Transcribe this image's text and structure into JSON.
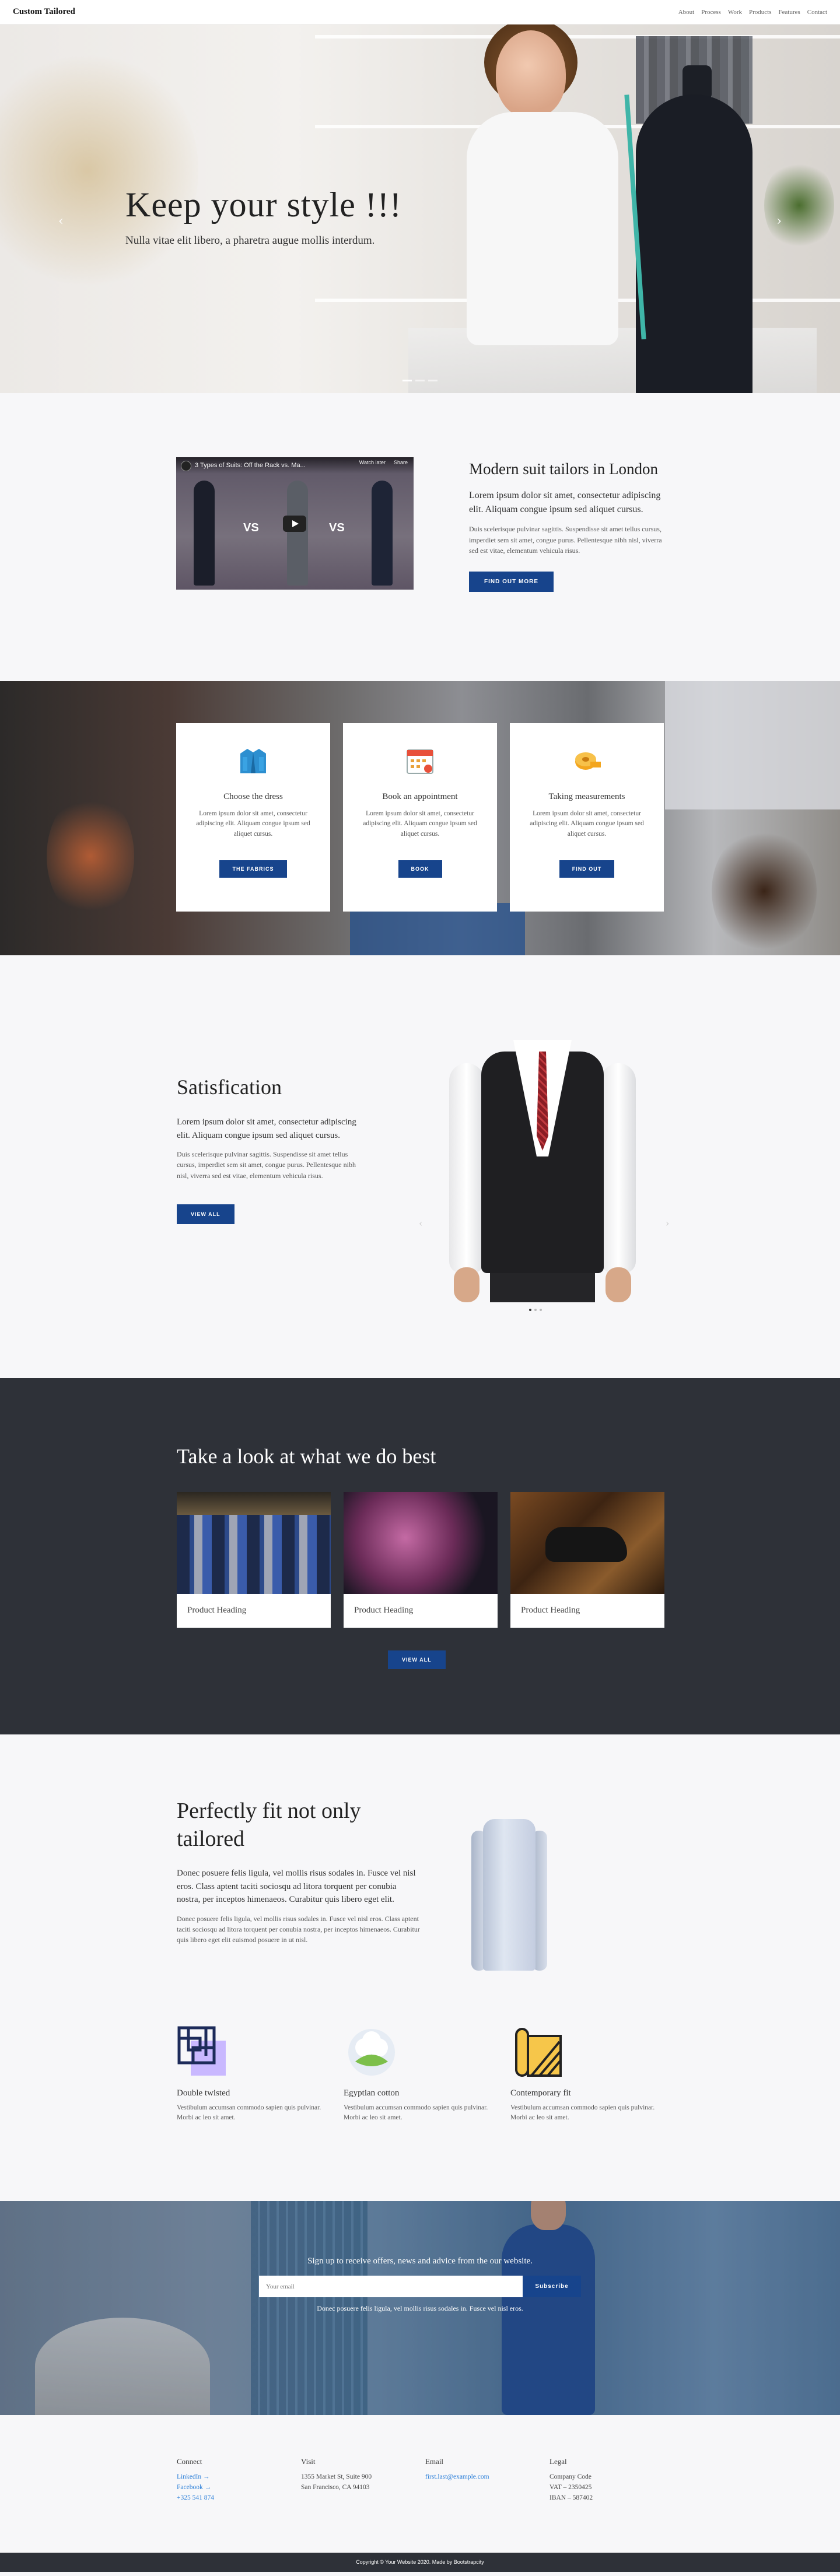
{
  "nav": {
    "brand": "Custom Tailored",
    "links": [
      "About",
      "Process",
      "Work",
      "Products",
      "Features",
      "Contact"
    ]
  },
  "hero": {
    "title": "Keep your style !!!",
    "subtitle": "Nulla vitae elit libero, a pharetra augue mollis interdum.",
    "prev": "‹",
    "next": "›"
  },
  "intro": {
    "video_title": "3 Types of Suits: Off the Rack vs. Ma...",
    "video_watch_later": "Watch later",
    "video_share": "Share",
    "vs1": "VS",
    "vs2": "VS",
    "title": "Modern suit tailors in London",
    "lead": "Lorem ipsum dolor sit amet, consectetur adipiscing elit. Aliquam congue ipsum sed aliquet cursus.",
    "body": "Duis scelerisque pulvinar sagittis. Suspendisse sit amet tellus cursus, imperdiet sem sit amet, congue purus. Pellentesque nibh nisl, viverra sed est vitae, elementum vehicula risus.",
    "button": "Find out more"
  },
  "process": {
    "cards": [
      {
        "title": "Choose the dress",
        "text": "Lorem ipsum dolor sit amet, consectetur adipiscing elit. Aliquam congue ipsum sed aliquet cursus.",
        "button": "The fabrics"
      },
      {
        "title": "Book an appointment",
        "text": "Lorem ipsum dolor sit amet, consectetur adipiscing elit. Aliquam congue ipsum sed aliquet cursus.",
        "button": "Book"
      },
      {
        "title": "Taking measurements",
        "text": "Lorem ipsum dolor sit amet, consectetur adipiscing elit. Aliquam congue ipsum sed aliquet cursus.",
        "button": "Find out"
      }
    ]
  },
  "satisfaction": {
    "title": "Satisfication",
    "lead": "Lorem ipsum dolor sit amet, consectetur adipiscing elit. Aliquam congue ipsum sed aliquet cursus.",
    "body": "Duis scelerisque pulvinar sagittis. Suspendisse sit amet tellus cursus, imperdiet sem sit amet, congue purus. Pellentesque nibh nisl, viverra sed est vitae, elementum vehicula risus.",
    "button": "View all",
    "prev": "‹",
    "next": "›"
  },
  "work": {
    "title": "Take a look at what we do best",
    "products": [
      "Product Heading",
      "Product Heading",
      "Product Heading"
    ],
    "button": "View all"
  },
  "features": {
    "title": "Perfectly fit not only tailored",
    "lead": "Donec posuere felis ligula, vel mollis risus sodales in. Fusce vel nisl eros. Class aptent taciti sociosqu ad litora torquent per conubia nostra, per inceptos himenaeos. Curabitur quis libero eget elit.",
    "body": "Donec posuere felis ligula, vel mollis risus sodales in. Fusce vel nisl eros. Class aptent taciti sociosqu ad litora torquent per conubia nostra, per inceptos himenaeos. Curabitur quis libero eget elit euismod posuere in ut nisl.",
    "items": [
      {
        "title": "Double twisted",
        "text": "Vestibulum accumsan commodo sapien quis pulvinar. Morbi ac leo sit amet."
      },
      {
        "title": "Egyptian cotton",
        "text": "Vestibulum accumsan commodo sapien quis pulvinar. Morbi ac leo sit amet."
      },
      {
        "title": "Contemporary fit",
        "text": "Vestibulum accumsan commodo sapien quis pulvinar. Morbi ac leo sit amet."
      }
    ]
  },
  "subscribe": {
    "title": "Sign up to receive offers, news and advice from the our website.",
    "placeholder": "Your email",
    "button": "Subscribe",
    "note": "Donec posuere felis ligula, vel mollis risus sodales in. Fusce vel nisl eros."
  },
  "footer": {
    "connect": {
      "title": "Connect",
      "links": [
        "LinkedIn →",
        "Facebook →",
        "+325 541 874"
      ]
    },
    "visit": {
      "title": "Visit",
      "lines": [
        "1355 Market St, Suite 900",
        "San Francisco, CA 94103"
      ]
    },
    "email": {
      "title": "Email",
      "link": "first.last@example.com"
    },
    "legal": {
      "title": "Legal",
      "lines": [
        "Company Code",
        "VAT – 2350425",
        "IBAN – 587402"
      ]
    },
    "copyright": "Copyright © Your Website 2020. Made by Bootstrapcity"
  },
  "colors": {
    "accent": "#17448c",
    "dark": "#2e3138",
    "link": "#2a7ed8"
  }
}
